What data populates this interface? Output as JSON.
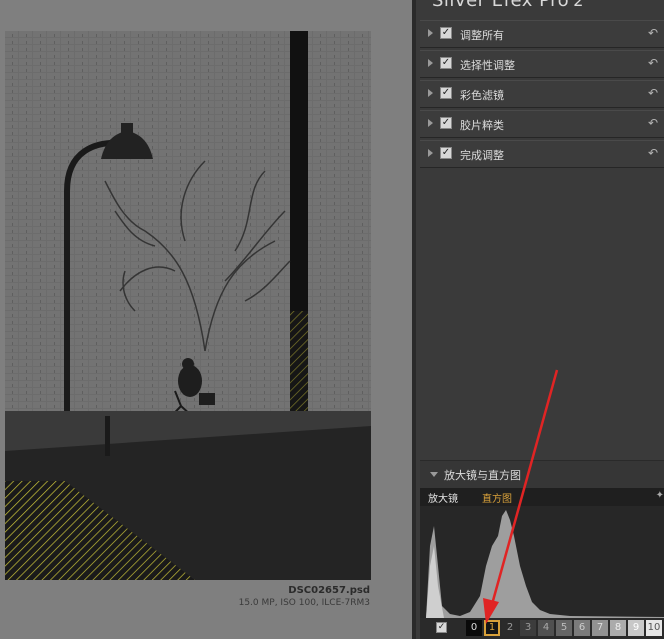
{
  "app": {
    "title": "Silver Efex Pro",
    "version": "2"
  },
  "file": {
    "name": "DSC02657.psd",
    "info": "15.0 MP, ISO 100, ILCE-7RM3"
  },
  "sections": [
    {
      "label": "调整所有",
      "checked": true
    },
    {
      "label": "选择性调整",
      "checked": true
    },
    {
      "label": "彩色滤镜",
      "checked": true
    },
    {
      "label": "胶片粹类",
      "checked": true
    },
    {
      "label": "完成调整",
      "checked": true
    }
  ],
  "loupe": {
    "header": "放大镜与直方图",
    "tab_loupe": "放大镜",
    "tab_histogram": "直方图"
  },
  "zones": {
    "labels": [
      "0",
      "1",
      "2",
      "3",
      "4",
      "5",
      "6",
      "7",
      "8",
      "9",
      "10"
    ],
    "selected": "1"
  },
  "colors": {
    "accent": "#d9a13a",
    "arrow": "#e02424",
    "panel": "#3a3a3a"
  },
  "icons": {
    "reset": "reset-arrow-icon",
    "expand": "triangle-right-icon",
    "pin": "pin-icon"
  }
}
